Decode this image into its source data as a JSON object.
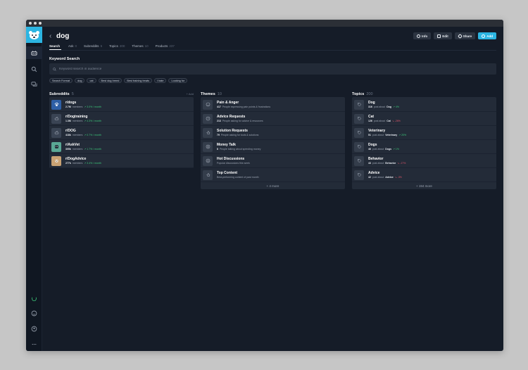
{
  "app": {
    "title": "dog"
  },
  "header": {
    "actions": [
      {
        "label": "Info",
        "icon": "info-icon"
      },
      {
        "label": "Edit",
        "icon": "edit-icon"
      },
      {
        "label": "Share",
        "icon": "link-icon"
      },
      {
        "label": "Add",
        "icon": "plus-circle-icon"
      }
    ]
  },
  "tabs": [
    {
      "label": "Search",
      "count": ""
    },
    {
      "label": "Ask",
      "count": "0"
    },
    {
      "label": "Subreddits",
      "count": "5"
    },
    {
      "label": "Topics",
      "count": "200"
    },
    {
      "label": "Themes",
      "count": "10"
    },
    {
      "label": "Products",
      "count": "237"
    }
  ],
  "keyword": {
    "label": "Keyword Search",
    "placeholder": "Keyword search in audience",
    "chips": [
      "Search Format",
      "dog",
      "cat",
      "Best dog breed",
      "Best training treats",
      "I hate",
      "Looking for"
    ]
  },
  "subreddits": {
    "title": "Subreddits",
    "count": "5",
    "add_label": "+ Add",
    "items": [
      {
        "name": "r/dogs",
        "members": "2.7M",
        "growth": "3.0% / month",
        "avatar_color": "#2e5fa6",
        "icon": "paw-icon"
      },
      {
        "name": "r/Dogtraining",
        "members": "1.3M",
        "growth": "4.3% / month",
        "avatar_color": "#3a4454",
        "icon": "reddit-icon"
      },
      {
        "name": "r/DOG",
        "members": "418k",
        "growth": "0.7% / month",
        "avatar_color": "#3a4454",
        "icon": "reddit-icon"
      },
      {
        "name": "r/AskVet",
        "members": "305k",
        "growth": "1.7% / month",
        "avatar_color": "#5aa895",
        "icon": "vet-icon"
      },
      {
        "name": "r/DogAdvice",
        "members": "277k",
        "growth": "3.4% / month",
        "avatar_color": "#c9a274",
        "icon": "dog-photo-icon"
      }
    ],
    "members_word": "members"
  },
  "themes": {
    "title": "Themes",
    "count": "10",
    "more": "+ 4 more",
    "items": [
      {
        "name": "Pain & Anger",
        "desc_count": "417",
        "desc": "People expressing pain points & frustrations",
        "icon": "frown-icon"
      },
      {
        "name": "Advice Requests",
        "desc_count": "213",
        "desc": "People asking for advice & resources",
        "icon": "question-icon"
      },
      {
        "name": "Solution Requests",
        "desc_count": "79",
        "desc": "People asking for tools & solutions",
        "icon": "thumb-icon"
      },
      {
        "name": "Money Talk",
        "desc_count": "8",
        "desc": "People talking about spending money",
        "icon": "dollar-icon"
      },
      {
        "name": "Hot Discussions",
        "desc_count": "",
        "desc": "Popular discussions this week",
        "icon": "flame-icon"
      },
      {
        "name": "Top Content",
        "desc_count": "",
        "desc": "Best-performing content of past month",
        "icon": "thumbs-up-icon"
      }
    ]
  },
  "topics": {
    "title": "Topics",
    "count": "200",
    "more": "+ 194 more",
    "items": [
      {
        "name": "Dog",
        "posts": "316",
        "about": "Dog",
        "trend": "4%",
        "dir": "up"
      },
      {
        "name": "Cat",
        "posts": "126",
        "about": "Cat",
        "trend": "-26%",
        "dir": "down"
      },
      {
        "name": "Veterinary",
        "posts": "51",
        "about": "Veterinary",
        "trend": "20%",
        "dir": "up"
      },
      {
        "name": "Dogs",
        "posts": "46",
        "about": "Dogs",
        "trend": "1%",
        "dir": "up"
      },
      {
        "name": "Behavior",
        "posts": "43",
        "about": "Behavior",
        "trend": "-17%",
        "dir": "down"
      },
      {
        "name": "Advice",
        "posts": "42",
        "about": "Advice",
        "trend": "-3%",
        "dir": "down"
      }
    ],
    "posts_word": "post about"
  },
  "colors": {
    "accent": "#2cb5e2",
    "up": "#3cc97a",
    "down": "#e0566a",
    "background": "#151c28",
    "card": "#232b38"
  }
}
